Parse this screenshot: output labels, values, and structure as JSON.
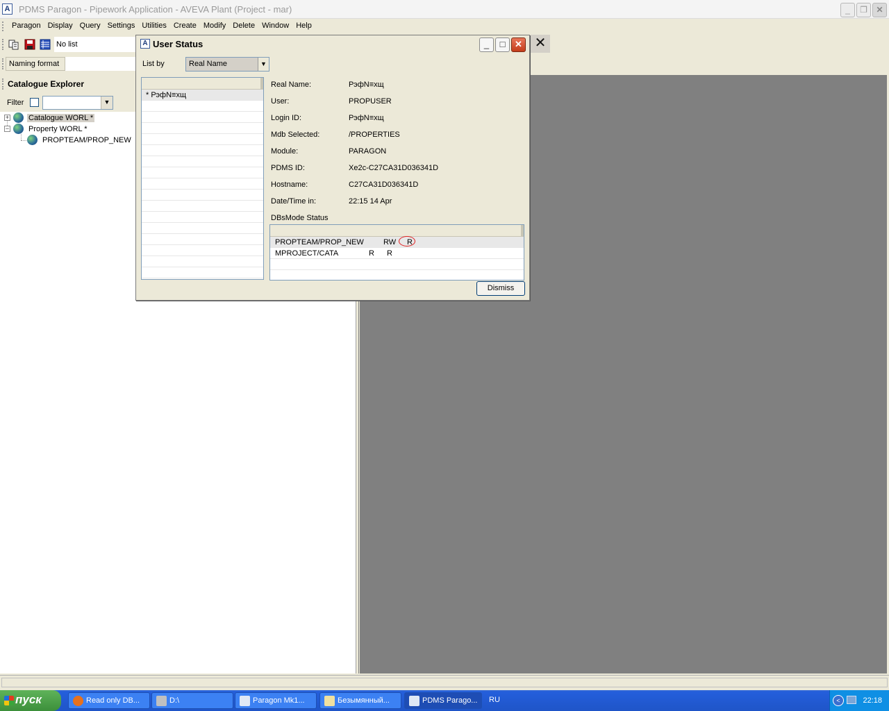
{
  "window": {
    "title": "PDMS Paragon - Pipework Application -  AVEVA Plant (Project - mar)",
    "app_icon": "A"
  },
  "menu": [
    "Paragon",
    "Display",
    "Query",
    "Settings",
    "Utilities",
    "Create",
    "Modify",
    "Delete",
    "Window",
    "Help"
  ],
  "toolbar": {
    "list_value": "No list",
    "naming_format_label": "Naming format",
    "close_glyph": "✕"
  },
  "explorer": {
    "title": "Catalogue Explorer",
    "filter_label": "Filter",
    "tree": [
      {
        "label": "Catalogue WORL *",
        "expander": "+",
        "selected": true
      },
      {
        "label": "Property WORL *",
        "expander": "−",
        "selected": false
      },
      {
        "label": "PROPTEAM/PROP_NEW",
        "expander": "",
        "selected": false
      }
    ]
  },
  "dialog": {
    "title": "User Status",
    "icon": "A",
    "list_by_label": "List by",
    "list_by_value": "Real Name",
    "users": [
      "* РэфN≡хщ"
    ],
    "fields": [
      {
        "label": "Real Name:",
        "value": "РэфN≡хщ"
      },
      {
        "label": "User:",
        "value": "PROPUSER"
      },
      {
        "label": "Login ID:",
        "value": "РэфN≡хщ"
      },
      {
        "label": "Mdb Selected:",
        "value": "/PROPERTIES"
      },
      {
        "label": "Module:",
        "value": "PARAGON"
      },
      {
        "label": "PDMS ID:",
        "value": "Xe2c-C27CA31D036341D"
      },
      {
        "label": "Hostname:",
        "value": "C27CA31D036341D"
      },
      {
        "label": "Date/Time in:",
        "value": "22:15 14 Apr"
      }
    ],
    "dbs_title": "DBsMode Status",
    "dbs_rows": [
      {
        "db": "PROPTEAM/PROP_NEW",
        "mode": "RW",
        "status": "R"
      },
      {
        "db": "MPROJECT/CATA",
        "mode": "R",
        "status": "R"
      }
    ],
    "dismiss_label": "Dismiss"
  },
  "taskbar": {
    "start_label": "пуск",
    "tasks": [
      {
        "label": "Read only DB...",
        "icon": "firefox-icon",
        "color": "#e8711c"
      },
      {
        "label": "D:\\",
        "icon": "drive-icon",
        "color": "#c0c0c0"
      },
      {
        "label": "Paragon Mk1...",
        "icon": "console-icon",
        "color": "#dfe8f5"
      },
      {
        "label": "Безымянный...",
        "icon": "paint-icon",
        "color": "#f0e0a0"
      },
      {
        "label": "PDMS Parago...",
        "icon": "aveva-icon",
        "color": "#dfe8f5"
      }
    ],
    "language": "RU",
    "clock": "22:18"
  }
}
